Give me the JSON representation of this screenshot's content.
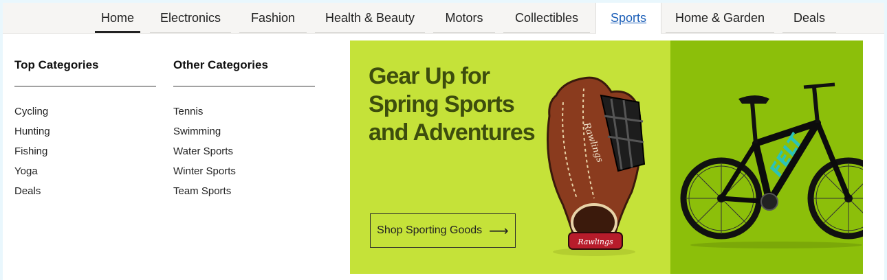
{
  "nav": {
    "items": [
      {
        "label": "Home",
        "state": "current"
      },
      {
        "label": "Electronics"
      },
      {
        "label": "Fashion"
      },
      {
        "label": "Health & Beauty"
      },
      {
        "label": "Motors"
      },
      {
        "label": "Collectibles"
      },
      {
        "label": "Sports",
        "state": "active"
      },
      {
        "label": "Home & Garden"
      },
      {
        "label": "Deals"
      }
    ]
  },
  "dropdown": {
    "top_categories": {
      "title": "Top Categories",
      "items": [
        "Cycling",
        "Hunting",
        "Fishing",
        "Yoga",
        "Deals"
      ]
    },
    "other_categories": {
      "title": "Other Categories",
      "items": [
        "Tennis",
        "Swimming",
        "Water Sports",
        "Winter Sports",
        "Team Sports"
      ]
    }
  },
  "banner": {
    "headline_line1": "Gear Up for",
    "headline_line2": "Spring Sports",
    "headline_line3": "and Adventures",
    "cta_label": "Shop Sporting Goods",
    "cta_icon": "arrow-right-icon",
    "glove_brand": "Rawlings",
    "bike_brand": "FELT",
    "colors": {
      "left_bg": "#c5e239",
      "right_bg": "#8cbf0a",
      "headline": "#3d4d0d"
    }
  },
  "colors": {
    "page_bg": "#e9f7fd",
    "nav_bg": "#f6f5f3",
    "active_link": "#1c5fb8"
  }
}
